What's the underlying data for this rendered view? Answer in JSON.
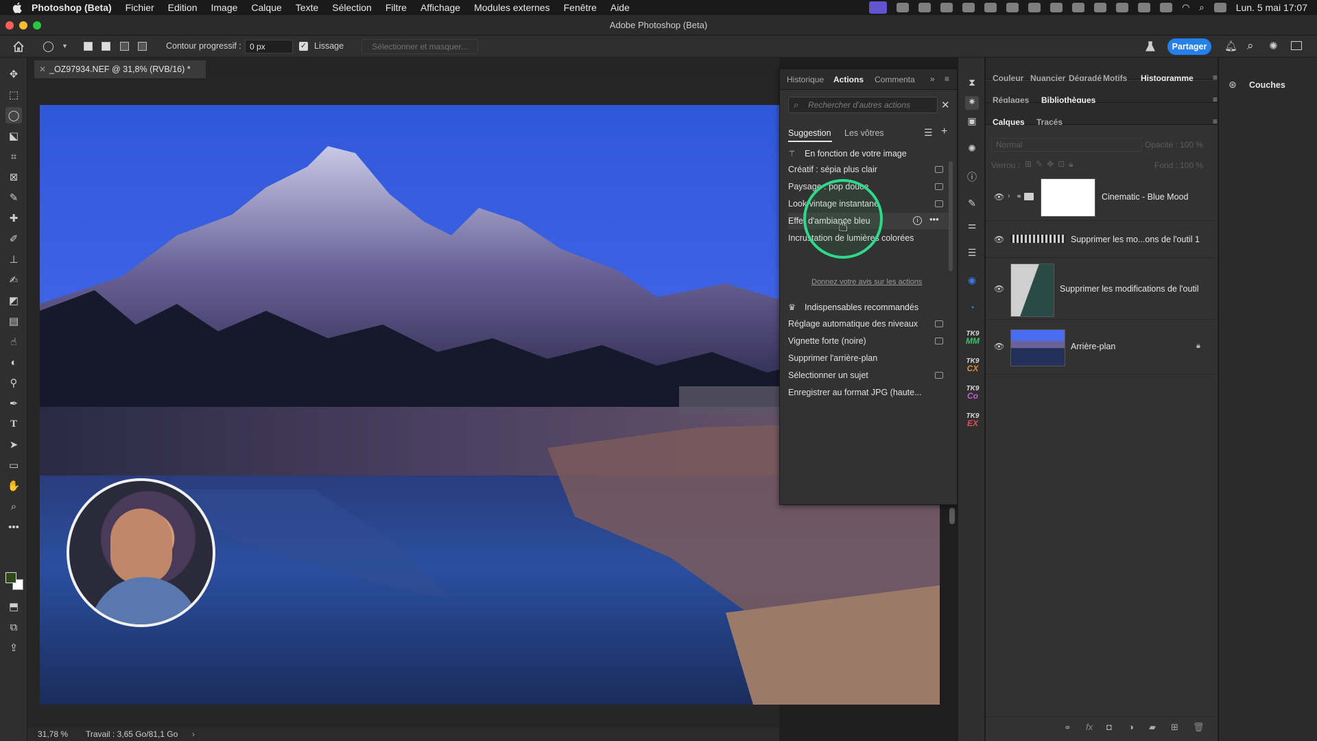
{
  "menubar": {
    "app_name": "Photoshop (Beta)",
    "items": [
      "Fichier",
      "Edition",
      "Image",
      "Calque",
      "Texte",
      "Sélection",
      "Filtre",
      "Affichage",
      "Modules externes",
      "Fenêtre",
      "Aide"
    ],
    "clock": "Lun. 5 mai  17:07"
  },
  "window": {
    "title": "Adobe Photoshop (Beta)"
  },
  "options": {
    "feather_label": "Contour progressif :",
    "feather_value": "0 px",
    "antialias_label": "Lissage",
    "select_mask_label": "Sélectionner et masquer...",
    "share_label": "Partager"
  },
  "document": {
    "tab_title": "_OZ97934.NEF @ 31,8% (RVB/16) *",
    "zoom": "31,78 %",
    "work_info": "Travail : 3,65 Go/81,1 Go"
  },
  "actions_panel": {
    "tabs": [
      "Historique",
      "Actions",
      "Commenta"
    ],
    "search_placeholder": "Rechercher d'autres actions",
    "subtabs": [
      "Suggestion",
      "Les vôtres"
    ],
    "section1_title": "En fonction de votre image",
    "section1_items": [
      "Créatif : sépia plus clair",
      "Paysage : pop douce",
      "Look vintage instantané",
      "Effet d'ambiance bleu",
      "Incrustation de lumières colorées"
    ],
    "feedback_link": "Donnez votre avis sur les actions",
    "section2_title": "Indispensables recommandés",
    "section2_items": [
      "Réglage automatique des niveaux",
      "Vignette forte (noire)",
      "Supprimer l'arrière-plan",
      "Sélectionner un sujet",
      "Enregistrer au format JPG (haute..."
    ]
  },
  "right_dock": {
    "tabs_row1": [
      "Couleur",
      "Nuancier",
      "Dégradé",
      "Motifs",
      "Histogramme"
    ],
    "tabs_row2": [
      "Réglages",
      "Bibliothèques"
    ],
    "tabs_row3": [
      "Calques",
      "Tracés"
    ],
    "blend_mode": "Normal",
    "opacity_label": "Opacité :",
    "opacity_value": "100 %",
    "lock_label": "Verrou :",
    "fill_label": "Fond :",
    "fill_value": "100 %",
    "layers": [
      "Cinematic - Blue Mood",
      "Supprimer les mo...ons de l'outil 1",
      "Supprimer les modifications de l'outil",
      "Arrière-plan"
    ],
    "couches_label": "Couches"
  },
  "strip": {
    "tk_labels": [
      [
        "TK9",
        "MM"
      ],
      [
        "TK9",
        "CX"
      ],
      [
        "TK9",
        "Co"
      ],
      [
        "TK9",
        "EX"
      ]
    ]
  },
  "colors": {
    "accent_blue": "#2680eb",
    "highlight_ring": "#2ed98a",
    "tk_mm": "#3fbf6a",
    "tk_cx": "#e0903a",
    "tk_co": "#c060d0",
    "tk_ex": "#e05050"
  }
}
